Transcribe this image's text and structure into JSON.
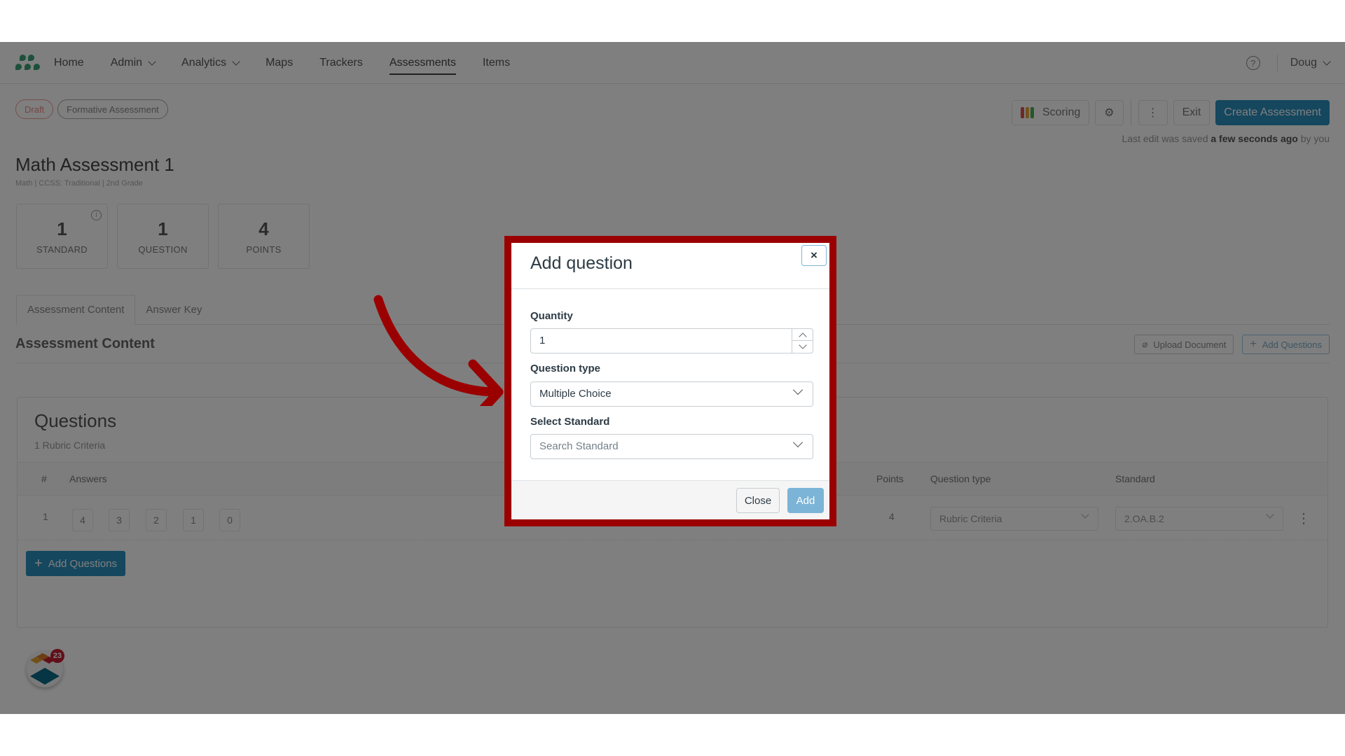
{
  "nav": {
    "items": [
      {
        "label": "Home",
        "has_dropdown": false
      },
      {
        "label": "Admin",
        "has_dropdown": true
      },
      {
        "label": "Analytics",
        "has_dropdown": true
      },
      {
        "label": "Maps",
        "has_dropdown": false
      },
      {
        "label": "Trackers",
        "has_dropdown": false
      },
      {
        "label": "Assessments",
        "has_dropdown": false,
        "active": true
      },
      {
        "label": "Items",
        "has_dropdown": false
      }
    ],
    "help_glyph": "?",
    "user_name": "Doug"
  },
  "header": {
    "badges": {
      "status": "Draft",
      "type": "Formative Assessment"
    },
    "actions": {
      "scoring_label": "Scoring",
      "settings_icon": "gear-icon",
      "more_glyph": "⋮",
      "exit_label": "Exit",
      "create_label": "Create Assessment"
    },
    "last_edit": {
      "prefix": "Last edit was saved ",
      "emphasis": "a few seconds ago",
      "suffix": " by you"
    },
    "title": "Math Assessment 1",
    "subtitle": "Math | CCSS: Traditional | 2nd Grade"
  },
  "stats": [
    {
      "value": "1",
      "label": "STANDARD",
      "info": "i"
    },
    {
      "value": "1",
      "label": "QUESTION"
    },
    {
      "value": "4",
      "label": "POINTS"
    }
  ],
  "tabs": [
    {
      "label": "Assessment Content",
      "active": true
    },
    {
      "label": "Answer Key",
      "active": false
    }
  ],
  "content": {
    "section_title": "Assessment Content",
    "upload_label": "Upload Document",
    "add_questions_label": "Add Questions"
  },
  "questions": {
    "title": "Questions",
    "subtitle": "1 Rubric Criteria",
    "columns": {
      "index": "#",
      "answers": "Answers",
      "points": "Points",
      "question_type": "Question type",
      "standard": "Standard"
    },
    "rows": [
      {
        "index": "1",
        "answers": [
          "4",
          "3",
          "2",
          "1",
          "0"
        ],
        "points": "4",
        "question_type": "Rubric Criteria",
        "standard": "2.OA.B.2"
      }
    ],
    "add_button_label": "Add Questions",
    "plus_glyph": "+"
  },
  "brand_bubble": {
    "badge_count": "23"
  },
  "modal": {
    "title": "Add question",
    "close_glyph": "×",
    "quantity": {
      "label": "Quantity",
      "value": "1"
    },
    "question_type": {
      "label": "Question type",
      "value": "Multiple Choice"
    },
    "standard": {
      "label": "Select Standard",
      "placeholder": "Search Standard"
    },
    "footer": {
      "close_label": "Close",
      "add_label": "Add"
    }
  },
  "annotation": {
    "highlight_color": "#9b0000",
    "arrow_color": "#9b0000"
  },
  "colors": {
    "primary": "#2b8fbd",
    "add_button": "#7bb4d6",
    "logo_green": "#3aa076",
    "badge_red": "#c51d33"
  }
}
